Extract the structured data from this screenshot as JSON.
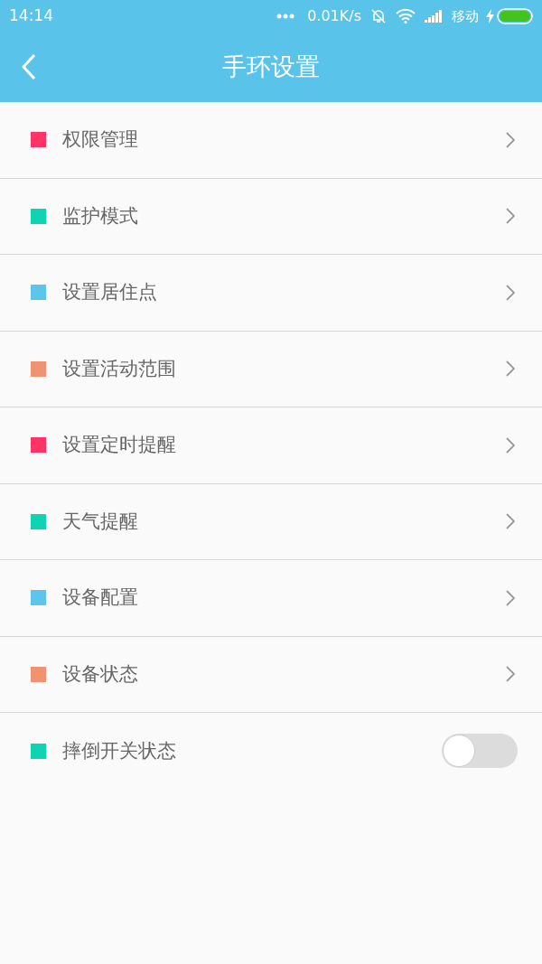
{
  "status_bar": {
    "time": "14:14",
    "speed": "0.01K/s",
    "carrier": "移动"
  },
  "header": {
    "title": "手环设置"
  },
  "items": [
    {
      "kind": "link",
      "label": "权限管理",
      "color": "#ff3366"
    },
    {
      "kind": "link",
      "label": "监护模式",
      "color": "#0fd3b1"
    },
    {
      "kind": "link",
      "label": "设置居住点",
      "color": "#5bc5ea"
    },
    {
      "kind": "link",
      "label": "设置活动范围",
      "color": "#ef9373"
    },
    {
      "kind": "link",
      "label": "设置定时提醒",
      "color": "#ff3366"
    },
    {
      "kind": "link",
      "label": "天气提醒",
      "color": "#0fd3b1"
    },
    {
      "kind": "link",
      "label": "设备配置",
      "color": "#5bc5ea"
    },
    {
      "kind": "link",
      "label": "设备状态",
      "color": "#ef9373"
    },
    {
      "kind": "toggle",
      "label": "摔倒开关状态",
      "color": "#0fd3b1",
      "on": false
    }
  ]
}
